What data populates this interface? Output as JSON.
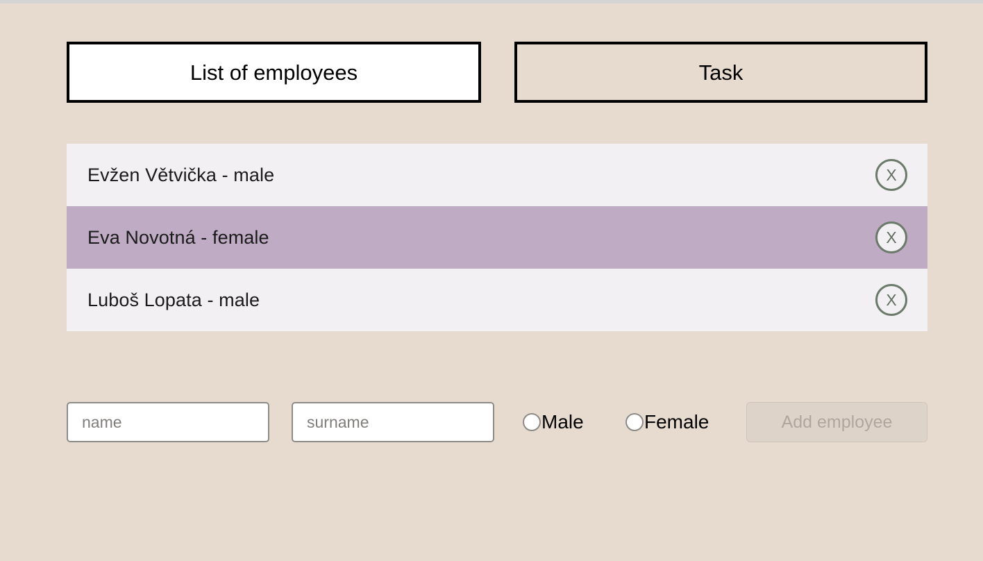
{
  "app": {
    "background_color": "#e7dbcf",
    "top_strip_color": "#d4d4d4"
  },
  "tabs": {
    "items": [
      {
        "id": "list-of-employees",
        "label": "List of employees",
        "active": true
      },
      {
        "id": "task",
        "label": "Task",
        "active": false
      }
    ]
  },
  "employee_list": {
    "selected_index": 1,
    "selected_color": "#bfabc3",
    "row_color": "#f2f0f2",
    "remove_icon_label": "X",
    "rows": [
      {
        "name": "Evžen Větvička",
        "gender": "male",
        "text": "Evžen Větvička - male",
        "selected": false
      },
      {
        "name": "Eva Novotná",
        "gender": "female",
        "text": "Eva Novotná - female",
        "selected": true
      },
      {
        "name": "Luboš Lopata",
        "gender": "male",
        "text": "Luboš Lopata - male",
        "selected": false
      }
    ]
  },
  "add_form": {
    "name_value": "",
    "name_placeholder": "name",
    "surname_value": "",
    "surname_placeholder": "surname",
    "gender_options": [
      {
        "id": "male",
        "label": "Male",
        "checked": false
      },
      {
        "id": "female",
        "label": "Female",
        "checked": false
      }
    ],
    "submit_label": "Add employee",
    "submit_disabled": true
  }
}
